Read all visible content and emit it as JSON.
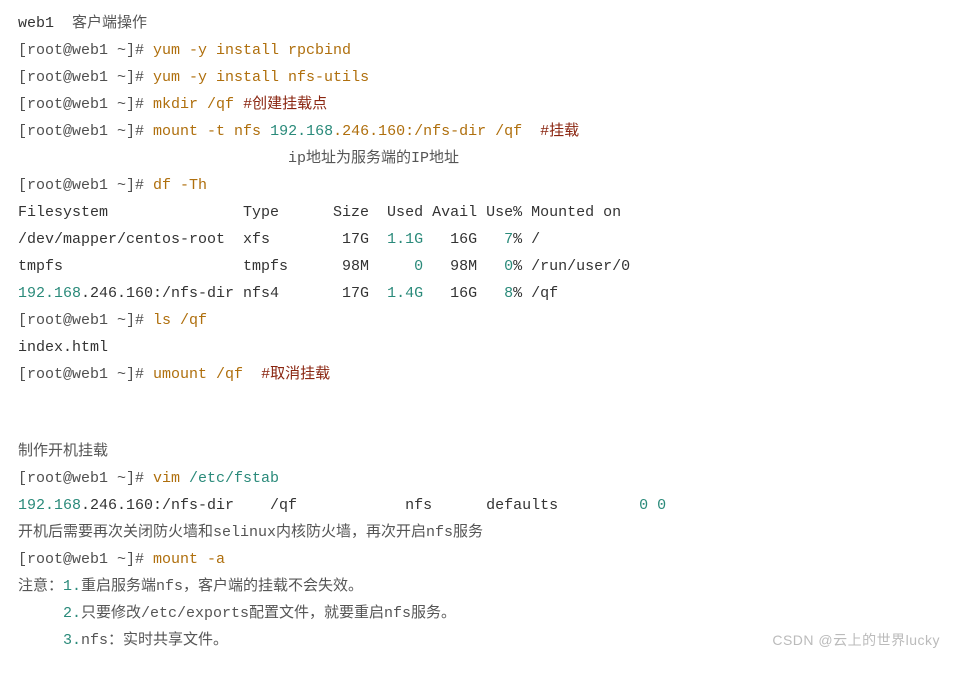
{
  "lines": {
    "l1_a": "web1",
    "l1_b": "  客户端操作",
    "l2_a": "[root@web1 ~]# ",
    "l2_b": "yum -y install rpcbind",
    "l3_a": "[root@web1 ~]# ",
    "l3_b": "yum -y install nfs-utils",
    "l4_a": "[root@web1 ~]# ",
    "l4_b": "mkdir ",
    "l4_c": "/qf ",
    "l4_d": "#创建挂载点",
    "l5_a": "[root@web1 ~]# ",
    "l5_b": "mount -t nfs ",
    "l5_c": "192.168",
    "l5_d": ".246.160:/nfs-dir /qf  ",
    "l5_e": "#挂载",
    "l6_a": "                              ",
    "l6_b": "ip地址为服务端的IP地址",
    "l7_a": "[root@web1 ~]# ",
    "l7_b": "df -Th",
    "l8": "Filesystem               Type      Size  Used Avail Use% Mounted on",
    "l9_a": "/dev/mapper/centos-root  xfs        17G  ",
    "l9_b": "1.1G",
    "l9_c": "   16G   ",
    "l9_d": "7",
    "l9_e": "% /",
    "l10_a": "tmpfs                    tmpfs      98M     ",
    "l10_b": "0",
    "l10_c": "   98M   ",
    "l10_d": "0",
    "l10_e": "% /run/user/0",
    "l11_a": "192.168",
    "l11_b": ".246.160:/nfs-dir nfs4       17G  ",
    "l11_c": "1.4G",
    "l11_d": "   16G   ",
    "l11_e": "8",
    "l11_f": "% /qf",
    "l12_a": "[root@web1 ~]# ",
    "l12_b": "ls ",
    "l12_c": "/qf",
    "l13": "index.html",
    "l14_a": "[root@web1 ~]# ",
    "l14_b": "umount /qf  ",
    "l14_c": "#取消挂载",
    "l15": "制作开机挂载",
    "l16_a": "[root@web1 ~]# ",
    "l16_b": "vim ",
    "l16_c": "/etc/fstab",
    "l17_a": "192.168",
    "l17_b": ".246.160:/nfs-dir    /qf            nfs      defaults         ",
    "l17_c": "0",
    "l17_d": " ",
    "l17_e": "0",
    "l18_a": "开机后需要再次关闭防火墙和selinux内核防火墙，再次开启nfs服务",
    "l19_a": "[root@web1 ~]# ",
    "l19_b": "mount -a",
    "l20_a": "注意：",
    "l20_b": "1.",
    "l20_c": "重启服务端nfs，客户端的挂载不会失效。",
    "l21_a": "     ",
    "l21_b": "2.",
    "l21_c": "只要修改/etc/exports配置文件，就要重启nfs服务。",
    "l22_a": "     ",
    "l22_b": "3.",
    "l22_c": "nfs：实时共享文件。"
  },
  "watermark": "CSDN @云上的世界lucky"
}
